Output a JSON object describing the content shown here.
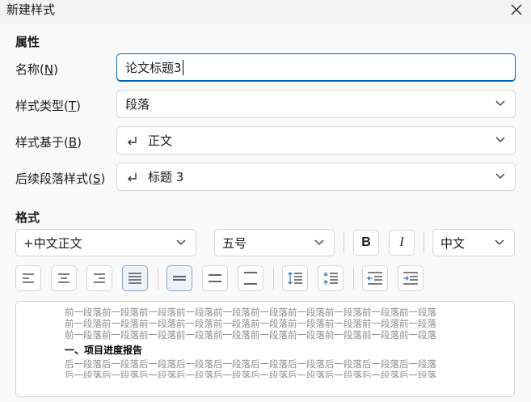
{
  "window": {
    "title": "新建样式"
  },
  "properties": {
    "section_title": "属性",
    "name": {
      "label": "名称(N)",
      "label_prefix": "名称(",
      "label_key": "N",
      "label_suffix": ")",
      "value": "论文标题3"
    },
    "style_type": {
      "label_prefix": "样式类型(",
      "label_key": "T",
      "label_suffix": ")",
      "value": "段落"
    },
    "based_on": {
      "label_prefix": "样式基于(",
      "label_key": "B",
      "label_suffix": ")",
      "value": "正文"
    },
    "next_style": {
      "label_prefix": "后续段落样式(",
      "label_key": "S",
      "label_suffix": ")",
      "value": "标题 3"
    }
  },
  "format": {
    "section_title": "格式",
    "font": "+中文正文",
    "size": "五号",
    "bold_label": "B",
    "italic_label": "I",
    "script": "中文"
  },
  "toolbar": {
    "buttons": [
      "align-left",
      "align-center",
      "align-right",
      "justify",
      "line-spacing-single",
      "line-spacing-1-5",
      "line-spacing-double",
      "space-increase",
      "space-decrease",
      "indent-decrease",
      "indent-increase"
    ],
    "selected": [
      "justify",
      "line-spacing-single"
    ]
  },
  "preview": {
    "prev_para_lines": [
      "前一段落前一段落前一段落前一段落前一段落前一段落前一段落前一段落前一段落前一段落",
      "前一段落前一段落前一段落前一段落前一段落前一段落前一段落前一段落前一段落前一段落",
      "前一段落前一段落前一段落前一段落前一段落前一段落前一段落前一段落前一段落前一段落"
    ],
    "sample_heading": "一、项目进度报告",
    "next_para_lines": [
      "后一段落后一段落后一段落后一段落后一段落后一段落后一段落后一段落后一段落后一段落",
      "后一段落后一段落后一段落后一段落后一段落后一段落后一段落后一段落后一段落后一段落"
    ]
  },
  "colors": {
    "accent": "#0067c0",
    "selected_bg": "#eef3f9"
  }
}
